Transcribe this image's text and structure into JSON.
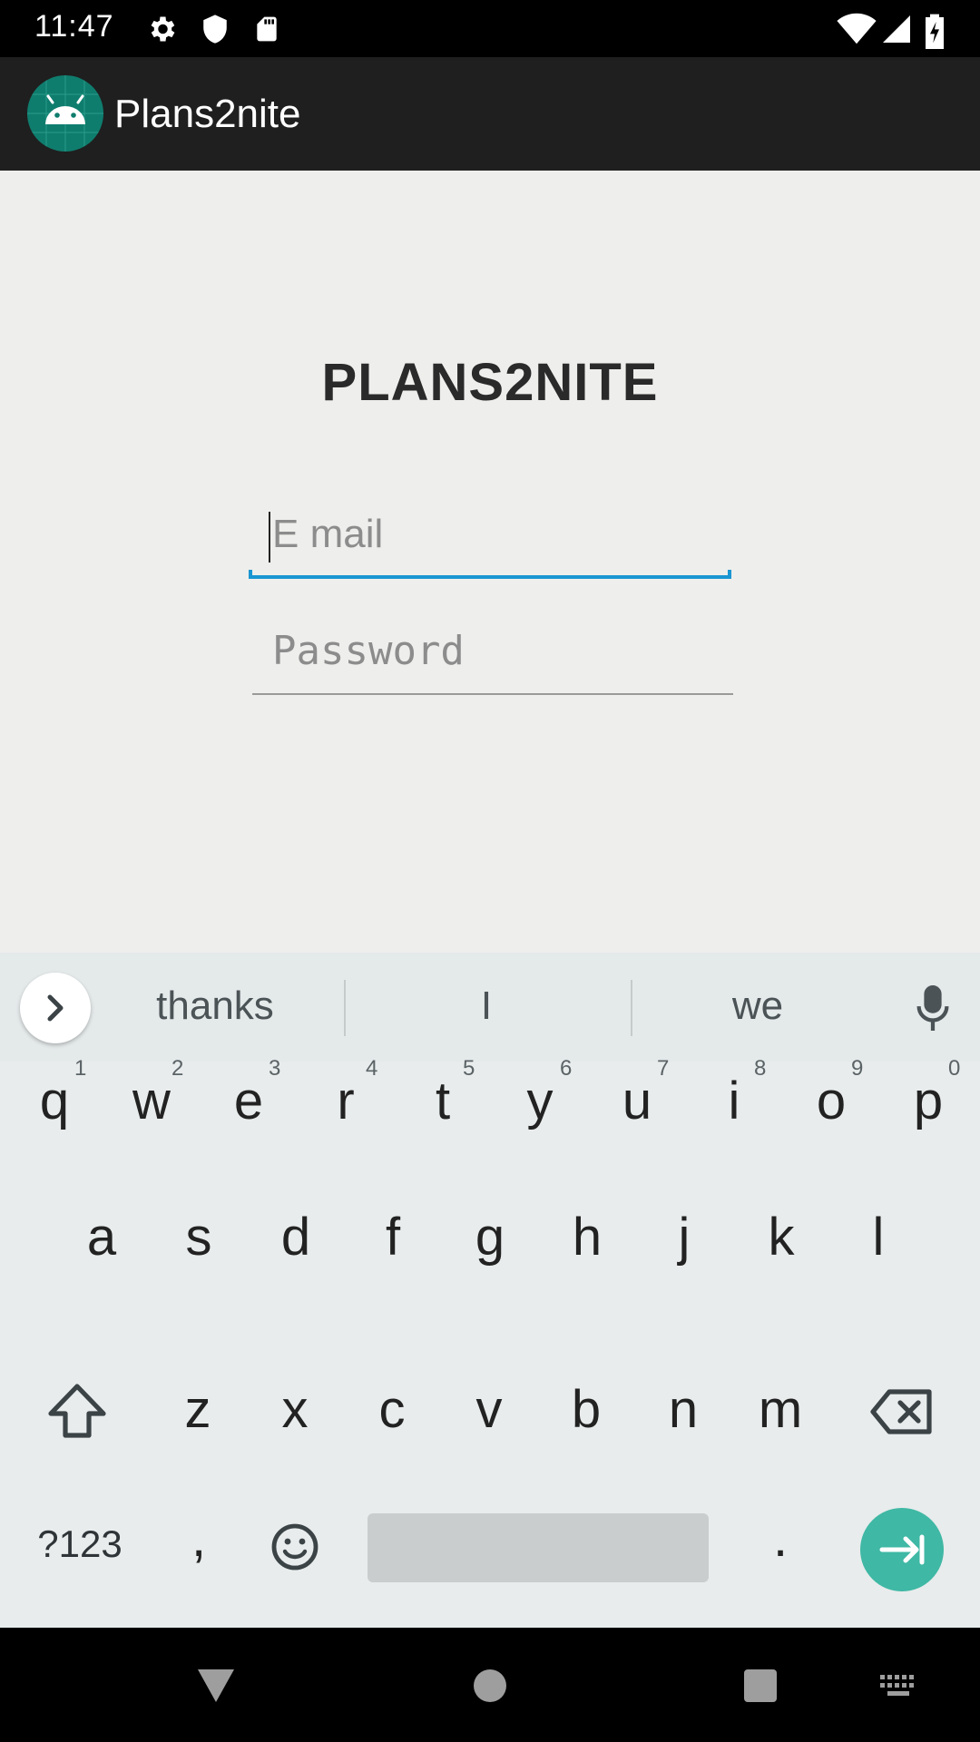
{
  "status_bar": {
    "time": "11:47",
    "icons": [
      "gear-icon",
      "shield-icon",
      "sd-card-icon",
      "wifi-icon",
      "signal-icon",
      "battery-icon"
    ]
  },
  "app_bar": {
    "title": "Plans2nite",
    "logo_icon": "android-icon"
  },
  "login": {
    "brand": "PLANS2NITE",
    "email_placeholder": "E mail",
    "password_placeholder": "Password"
  },
  "keyboard": {
    "suggestions": [
      "thanks",
      "I",
      "we"
    ],
    "row1": [
      "q",
      "w",
      "e",
      "r",
      "t",
      "y",
      "u",
      "i",
      "o",
      "p"
    ],
    "row1_numbers": [
      "1",
      "2",
      "3",
      "4",
      "5",
      "6",
      "7",
      "8",
      "9",
      "0"
    ],
    "row2": [
      "a",
      "s",
      "d",
      "f",
      "g",
      "h",
      "j",
      "k",
      "l"
    ],
    "row3": [
      "z",
      "x",
      "c",
      "v",
      "b",
      "n",
      "m"
    ],
    "symbols_label": "?123",
    "comma": ",",
    "period": "."
  },
  "colors": {
    "accent": "#1a96d2",
    "enter": "#3fb8a5",
    "app_bar": "#1f1f1f",
    "background": "#eeeeec"
  }
}
